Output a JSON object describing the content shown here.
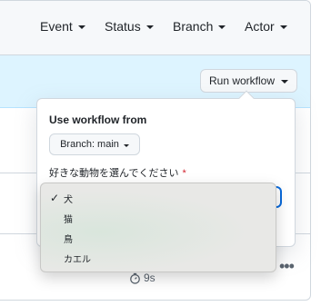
{
  "filters": [
    {
      "label": "Event"
    },
    {
      "label": "Status"
    },
    {
      "label": "Branch"
    },
    {
      "label": "Actor"
    }
  ],
  "run_workflow_button": "Run workflow",
  "popover": {
    "title": "Use workflow from",
    "branch_button": "Branch: main",
    "field_label": "好きな動物を選んでください",
    "required_marker": "*"
  },
  "dropdown": {
    "selected_index": 0,
    "options": [
      {
        "label": "犬",
        "checked": true
      },
      {
        "label": "猫",
        "checked": false
      },
      {
        "label": "鳥",
        "checked": false
      },
      {
        "label": "カエル",
        "checked": false
      }
    ]
  },
  "run_row": {
    "duration": "9s"
  },
  "colors": {
    "banner": "#ddf4ff",
    "accent": "#0969da",
    "required": "#d1242f"
  }
}
